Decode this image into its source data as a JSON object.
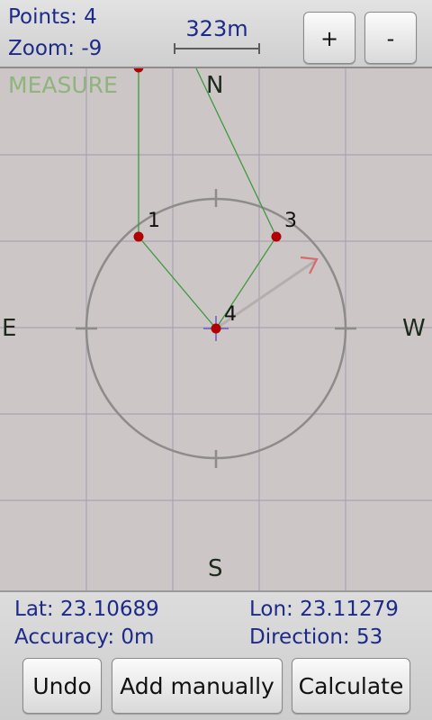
{
  "header": {
    "points_text": "Points: 4",
    "zoom_text": "Zoom: -9",
    "scale_label": "323m",
    "zoom_in_label": "+",
    "zoom_out_label": "-"
  },
  "map": {
    "mode_label": "MEASURE",
    "compass": {
      "north": "N",
      "south": "S",
      "east": "E",
      "west": "W"
    },
    "point_labels": [
      "1",
      "3",
      "4"
    ]
  },
  "footer": {
    "lat_text": "Lat: 23.10689",
    "lon_text": "Lon: 23.11279",
    "accuracy_text": "Accuracy: 0m",
    "direction_text": "Direction: 53",
    "undo_label": "Undo",
    "add_manually_label": "Add manually",
    "calculate_label": "Calculate"
  },
  "colors": {
    "point": "#b00000",
    "track": "#3f9a3f",
    "heading_arrow": "#d86a6a",
    "text": "#1c2a88",
    "mode_label": "#8fb47c"
  }
}
